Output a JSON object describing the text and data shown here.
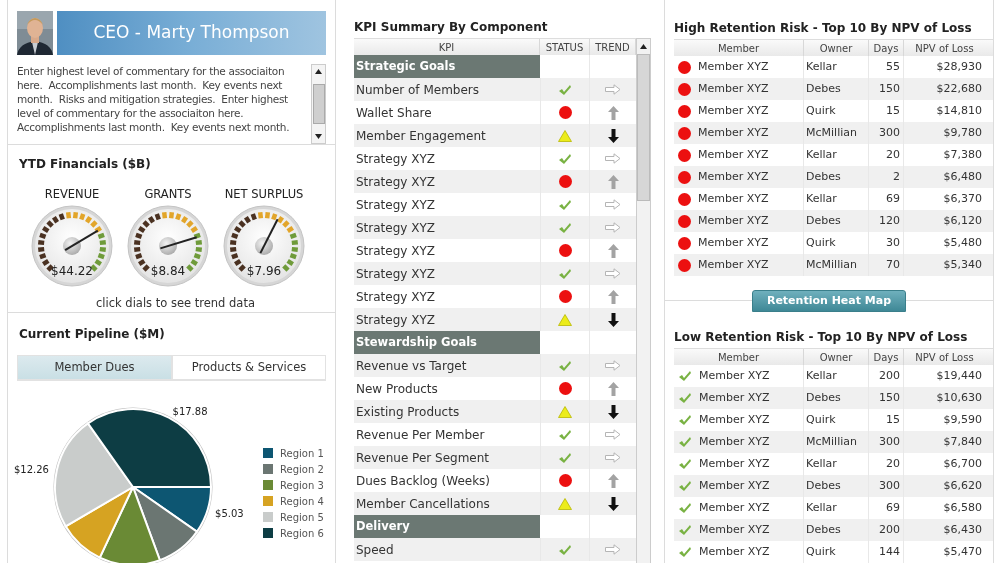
{
  "ceo": {
    "title": "CEO - Marty Thompson",
    "commentary": "Enter highest level of commentary for the associaiton here.  Accomplishments last month.  Key events next month.  Risks and mitigation strategies.  Enter highest level of commentary for the associaiton here.  Accomplishments last month.  Key events next month."
  },
  "ytd": {
    "title": "YTD Financials ($B)",
    "gauges": [
      {
        "label": "REVENUE",
        "value": "$44.22",
        "level": 0.72
      },
      {
        "label": "GRANTS",
        "value": "$8.84",
        "level": 0.77
      },
      {
        "label": "NET SURPLUS",
        "value": "$7.96",
        "level": 0.6
      }
    ],
    "hint": "click dials to see trend data"
  },
  "pipeline": {
    "title": "Current Pipeline ($M)",
    "tabs": [
      {
        "label": "Member Dues",
        "selected": true
      },
      {
        "label": "Products & Services",
        "selected": false
      }
    ],
    "chart_data": {
      "type": "pie",
      "categories": [
        "Region 1",
        "Region 2",
        "Region 3",
        "Region 4",
        "Region 5",
        "Region 6"
      ],
      "colors": [
        "#0d5672",
        "#6b7672",
        "#6a8a35",
        "#d6a322",
        "#c9cccb",
        "#0d3d44"
      ],
      "legend": "right",
      "series": [
        {
          "values": [
            9.7,
            9.7,
            12.6,
            9.6,
            23.6,
            34.8
          ]
        }
      ],
      "value_labels": [
        "$5.03",
        null,
        null,
        null,
        "$12.26",
        "$17.88"
      ]
    }
  },
  "kpi": {
    "title": "KPI Summary By Component",
    "columns": [
      "KPI",
      "STATUS",
      "TREND"
    ],
    "rows": [
      {
        "kind": "group",
        "label": "Strategic Goals"
      },
      {
        "kind": "kpi",
        "label": "Number of Members",
        "status": {
          "kind": "ok"
        },
        "trend": {
          "kind": "flat"
        }
      },
      {
        "kind": "kpi",
        "label": "Wallet Share",
        "status": {
          "kind": "risk"
        },
        "trend": {
          "kind": "up"
        }
      },
      {
        "kind": "kpi",
        "label": "Member Engagement",
        "status": {
          "kind": "warn"
        },
        "trend": {
          "kind": "down"
        }
      },
      {
        "kind": "kpi",
        "label": "Strategy XYZ",
        "status": {
          "kind": "ok"
        },
        "trend": {
          "kind": "flat"
        }
      },
      {
        "kind": "kpi",
        "label": "Strategy XYZ",
        "status": {
          "kind": "risk"
        },
        "trend": {
          "kind": "up"
        }
      },
      {
        "kind": "kpi",
        "label": "Strategy XYZ",
        "status": {
          "kind": "ok"
        },
        "trend": {
          "kind": "flat"
        }
      },
      {
        "kind": "kpi",
        "label": "Strategy XYZ",
        "status": {
          "kind": "ok"
        },
        "trend": {
          "kind": "flat"
        }
      },
      {
        "kind": "kpi",
        "label": "Strategy XYZ",
        "status": {
          "kind": "risk"
        },
        "trend": {
          "kind": "up"
        }
      },
      {
        "kind": "kpi",
        "label": "Strategy XYZ",
        "status": {
          "kind": "ok"
        },
        "trend": {
          "kind": "flat"
        }
      },
      {
        "kind": "kpi",
        "label": "Strategy XYZ",
        "status": {
          "kind": "risk"
        },
        "trend": {
          "kind": "up"
        }
      },
      {
        "kind": "kpi",
        "label": "Strategy XYZ",
        "status": {
          "kind": "warn"
        },
        "trend": {
          "kind": "down"
        }
      },
      {
        "kind": "group",
        "label": "Stewardship Goals"
      },
      {
        "kind": "kpi",
        "label": "Revenue vs Target",
        "status": {
          "kind": "ok"
        },
        "trend": {
          "kind": "flat"
        }
      },
      {
        "kind": "kpi",
        "label": "New Products",
        "status": {
          "kind": "risk"
        },
        "trend": {
          "kind": "up"
        }
      },
      {
        "kind": "kpi",
        "label": "Existing Products",
        "status": {
          "kind": "warn"
        },
        "trend": {
          "kind": "down"
        }
      },
      {
        "kind": "kpi",
        "label": "Revenue Per Member",
        "status": {
          "kind": "ok"
        },
        "trend": {
          "kind": "flat"
        }
      },
      {
        "kind": "kpi",
        "label": "Revenue Per Segment",
        "status": {
          "kind": "ok"
        },
        "trend": {
          "kind": "flat"
        }
      },
      {
        "kind": "kpi",
        "label": "Dues Backlog (Weeks)",
        "status": {
          "kind": "risk"
        },
        "trend": {
          "kind": "up"
        }
      },
      {
        "kind": "kpi",
        "label": "Member Cancellations",
        "status": {
          "kind": "warn"
        },
        "trend": {
          "kind": "down"
        }
      },
      {
        "kind": "group",
        "label": "Delivery"
      },
      {
        "kind": "kpi",
        "label": "Speed",
        "status": {
          "kind": "ok"
        },
        "trend": {
          "kind": "flat"
        }
      }
    ]
  },
  "high_risk": {
    "title": "High Retention Risk - Top 10 By NPV of Loss",
    "columns": [
      "Member",
      "Owner",
      "Days",
      "NPV of Loss"
    ],
    "rows": [
      {
        "status": {
          "kind": "risk"
        },
        "member": "Member XYZ",
        "owner": "Kellar",
        "days": "55",
        "npv": "$28,930"
      },
      {
        "status": {
          "kind": "risk"
        },
        "member": "Member XYZ",
        "owner": "Debes",
        "days": "150",
        "npv": "$22,680"
      },
      {
        "status": {
          "kind": "risk"
        },
        "member": "Member XYZ",
        "owner": "Quirk",
        "days": "15",
        "npv": "$14,810"
      },
      {
        "status": {
          "kind": "risk"
        },
        "member": "Member XYZ",
        "owner": "McMillian",
        "days": "300",
        "npv": "$9,780"
      },
      {
        "status": {
          "kind": "risk"
        },
        "member": "Member XYZ",
        "owner": "Kellar",
        "days": "20",
        "npv": "$7,380"
      },
      {
        "status": {
          "kind": "risk"
        },
        "member": "Member XYZ",
        "owner": "Debes",
        "days": "2",
        "npv": "$6,480"
      },
      {
        "status": {
          "kind": "risk"
        },
        "member": "Member XYZ",
        "owner": "Kellar",
        "days": "69",
        "npv": "$6,370"
      },
      {
        "status": {
          "kind": "risk"
        },
        "member": "Member XYZ",
        "owner": "Debes",
        "days": "120",
        "npv": "$6,120"
      },
      {
        "status": {
          "kind": "risk"
        },
        "member": "Member XYZ",
        "owner": "Quirk",
        "days": "30",
        "npv": "$5,480"
      },
      {
        "status": {
          "kind": "risk"
        },
        "member": "Member XYZ",
        "owner": "McMillian",
        "days": "70",
        "npv": "$5,340"
      }
    ]
  },
  "heat_map_button": "Retention Heat Map",
  "low_risk": {
    "title": "Low Retention Risk - Top 10 By NPV of Loss",
    "columns": [
      "Member",
      "Owner",
      "Days",
      "NPV of Loss"
    ],
    "rows": [
      {
        "status": {
          "kind": "ok"
        },
        "member": "Member XYZ",
        "owner": "Kellar",
        "days": "200",
        "npv": "$19,440"
      },
      {
        "status": {
          "kind": "ok"
        },
        "member": "Member XYZ",
        "owner": "Debes",
        "days": "150",
        "npv": "$10,630"
      },
      {
        "status": {
          "kind": "ok"
        },
        "member": "Member XYZ",
        "owner": "Quirk",
        "days": "15",
        "npv": "$9,590"
      },
      {
        "status": {
          "kind": "ok"
        },
        "member": "Member XYZ",
        "owner": "McMillian",
        "days": "300",
        "npv": "$7,840"
      },
      {
        "status": {
          "kind": "ok"
        },
        "member": "Member XYZ",
        "owner": "Kellar",
        "days": "20",
        "npv": "$6,700"
      },
      {
        "status": {
          "kind": "ok"
        },
        "member": "Member XYZ",
        "owner": "Debes",
        "days": "300",
        "npv": "$6,620"
      },
      {
        "status": {
          "kind": "ok"
        },
        "member": "Member XYZ",
        "owner": "Kellar",
        "days": "69",
        "npv": "$6,580"
      },
      {
        "status": {
          "kind": "ok"
        },
        "member": "Member XYZ",
        "owner": "Debes",
        "days": "200",
        "npv": "$6,430"
      },
      {
        "status": {
          "kind": "ok"
        },
        "member": "Member XYZ",
        "owner": "Quirk",
        "days": "144",
        "npv": "$5,470"
      }
    ]
  }
}
